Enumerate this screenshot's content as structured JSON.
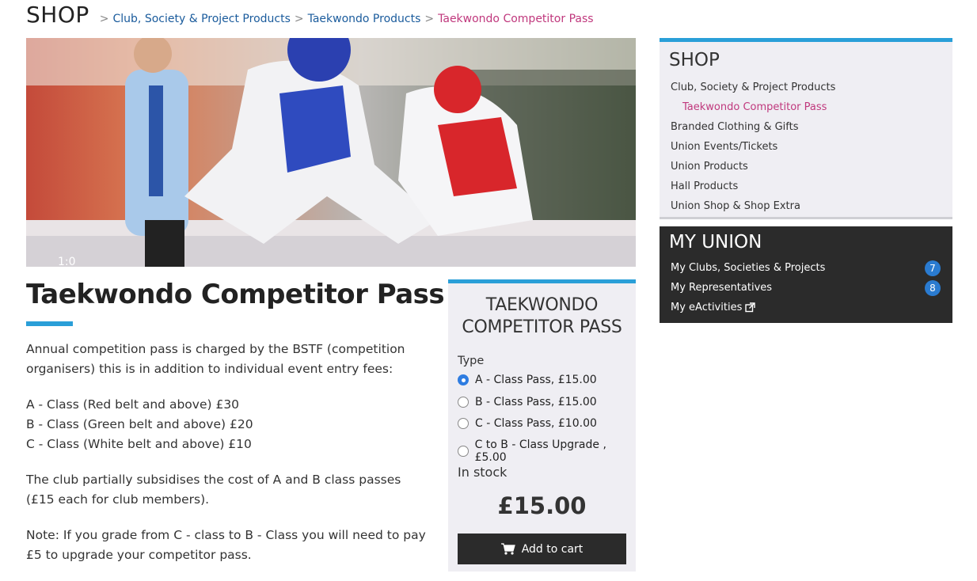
{
  "header": {
    "title": "SHOP",
    "breadcrumb": [
      "Club, Society & Project Products",
      "Taekwondo Products",
      "Taekwondo Competitor Pass"
    ],
    "separator": ">"
  },
  "product": {
    "title": "Taekwondo Competitor Pass",
    "description": [
      "Annual competition pass is charged by the BSTF (competition organisers) this is in addition to individual event entry fees:",
      "A - Class (Red belt and above) £30",
      "B - Class (Green belt and above) £20",
      "C - Class (White belt and above) £10",
      "The club partially subsidises the cost of A and B class passes (£15 each for club members).",
      "Note: If you grade from C - class to B - Class you will need to pay £5 to upgrade your competitor pass."
    ]
  },
  "buybox": {
    "title_line1": "TAEKWONDO",
    "title_line2": "COMPETITOR PASS",
    "type_label": "Type",
    "options": [
      {
        "label": "A - Class Pass, £15.00",
        "selected": true
      },
      {
        "label": "B - Class Pass, £15.00",
        "selected": false
      },
      {
        "label": "C - Class Pass, £10.00",
        "selected": false
      },
      {
        "label": "C to B - Class Upgrade , £5.00",
        "selected": false
      }
    ],
    "stock": "In stock",
    "price": "£15.00",
    "cart_label": "Add to cart"
  },
  "sidebar": {
    "shop_heading": "SHOP",
    "shop_items": [
      {
        "label": "Club, Society & Project Products",
        "sub": false
      },
      {
        "label": "Taekwondo Competitor Pass",
        "sub": true
      },
      {
        "label": "Branded Clothing & Gifts",
        "sub": false
      },
      {
        "label": "Union Events/Tickets",
        "sub": false
      },
      {
        "label": "Union Products",
        "sub": false
      },
      {
        "label": "Hall Products",
        "sub": false
      },
      {
        "label": "Union Shop & Shop Extra",
        "sub": false
      }
    ],
    "union_heading": "MY UNION",
    "union_items": [
      {
        "label": "My Clubs, Societies & Projects",
        "count": "7"
      },
      {
        "label": "My Representatives",
        "count": "8"
      },
      {
        "label": "My eActivities",
        "icon": "external-link-icon"
      }
    ]
  },
  "colors": {
    "accent_blue": "#2a9fd8",
    "link_blue": "#1a5b9c",
    "current_pink": "#c0387d",
    "dark_panel": "#2b2b2b",
    "light_panel": "#efeef3"
  }
}
